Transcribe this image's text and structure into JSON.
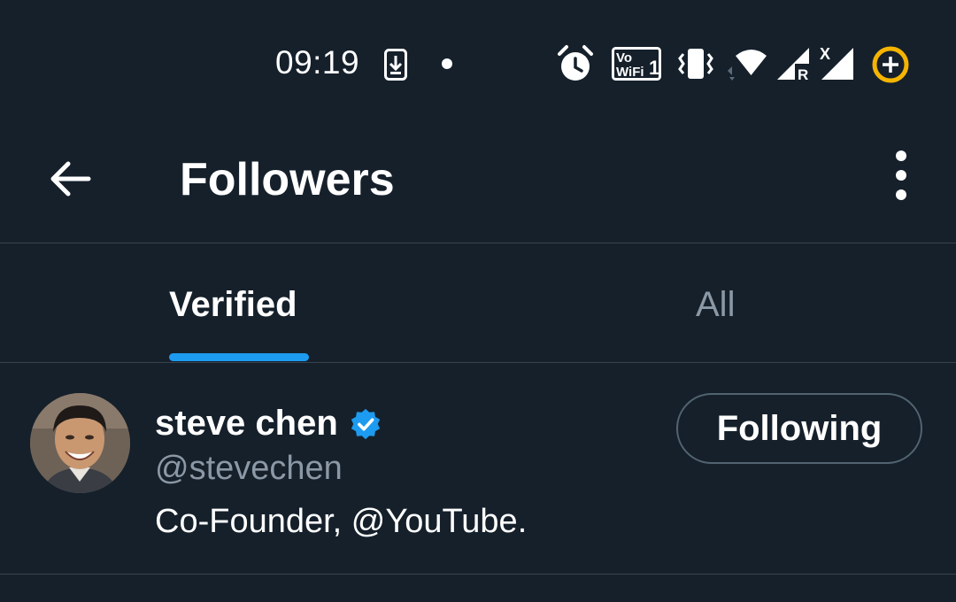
{
  "status_bar": {
    "time": "09:19",
    "icons": [
      "download-notification-icon",
      "dot-icon",
      "alarm-icon",
      "vowifi-icon",
      "vibrate-icon",
      "wifi-icon",
      "signal-roaming-icon",
      "signal-no-service-icon",
      "battery-saver-icon"
    ],
    "vowifi_line1": "Vo",
    "vowifi_line2": "WiFi",
    "vowifi_sim": "1",
    "roaming_letter": "R",
    "no_service_letter": "X"
  },
  "app_bar": {
    "title": "Followers"
  },
  "tabs": [
    {
      "label": "Verified",
      "selected": true
    },
    {
      "label": "All",
      "selected": false
    }
  ],
  "followers": [
    {
      "name": "steve chen",
      "verified": true,
      "handle": "@stevechen",
      "bio": "Co-Founder, @YouTube.",
      "button_label": "Following"
    }
  ],
  "colors": {
    "background": "#15202b",
    "accent": "#1d9bf0",
    "secondary_text": "#8b98a5",
    "divider": "#38444d",
    "battery_ring": "#f5b400"
  }
}
